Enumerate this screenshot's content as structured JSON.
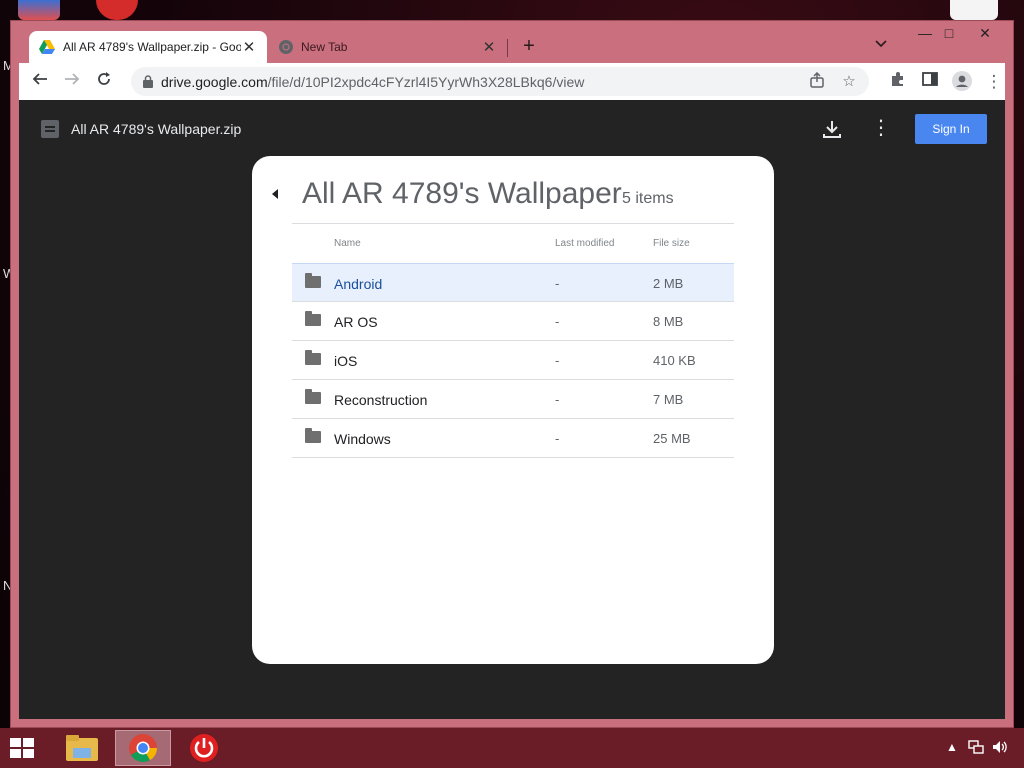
{
  "browser": {
    "tabs": [
      {
        "title": "All AR 4789's Wallpaper.zip - Goo",
        "icon": "google-drive-icon",
        "active": true
      },
      {
        "title": "New Tab",
        "icon": "chrome-icon",
        "active": false
      }
    ],
    "url_host": "drive.google.com",
    "url_path": "/file/d/10PI2xpdc4cFYzrl4I5YyrWh3X28LBkq6/view"
  },
  "viewer": {
    "file_title": "All AR 4789's Wallpaper.zip",
    "signin_label": "Sign In"
  },
  "zip": {
    "title": "All AR 4789's Wallpaper",
    "count": "5 items",
    "columns": {
      "name": "Name",
      "modified": "Last modified",
      "size": "File size"
    },
    "rows": [
      {
        "name": "Android",
        "modified": "-",
        "size": "2 MB",
        "selected": true
      },
      {
        "name": "AR OS",
        "modified": "-",
        "size": "8 MB"
      },
      {
        "name": "iOS",
        "modified": "-",
        "size": "410 KB"
      },
      {
        "name": "Reconstruction",
        "modified": "-",
        "size": "7 MB"
      },
      {
        "name": "Windows",
        "modified": "-",
        "size": "25 MB"
      }
    ]
  },
  "desktop": {
    "left_letters": [
      "M",
      "W",
      "N"
    ]
  },
  "colors": {
    "accent": "#4a86f0",
    "window_frame": "#c96f7d",
    "taskbar": "#6a1d27",
    "viewer_bg": "#232323"
  }
}
